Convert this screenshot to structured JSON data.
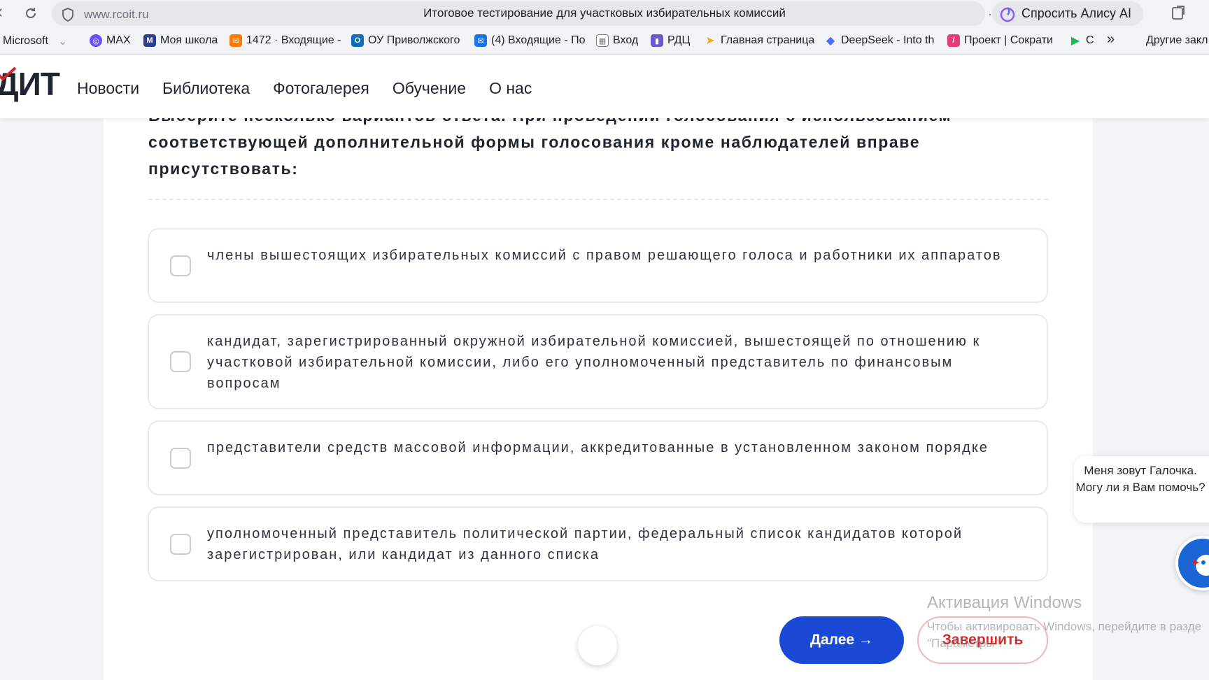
{
  "browser": {
    "url": "www.rcoit.ru",
    "tab_title": "Итоговое тестирование для участковых избирательных комиссий",
    "more": "···",
    "alice_label": "Спросить Алису AI"
  },
  "bookmarks": {
    "items": [
      {
        "label": "Microsoft",
        "icon": "microsoft-icon",
        "color": "#444"
      },
      {
        "label": "MAX",
        "icon": "max-icon",
        "color": "#6b4dff"
      },
      {
        "label": "Моя школа",
        "icon": "moya-shkola-icon",
        "color": "#2d3f8c"
      },
      {
        "label": "1472 · Входящие -",
        "icon": "mail-icon",
        "color": "#ff7a00"
      },
      {
        "label": "ОУ Приволжского",
        "icon": "outlook-icon",
        "color": "#0f6cbd"
      },
      {
        "label": "(4) Входящие - По",
        "icon": "inbox-icon",
        "color": "#1a73e8"
      },
      {
        "label": "Вход",
        "icon": "grid-icon",
        "color": "#777"
      },
      {
        "label": "РДЦ",
        "icon": "rdc-icon",
        "color": "#6a5acd"
      },
      {
        "label": "Главная страница",
        "icon": "send-icon",
        "color": "#f5a623"
      },
      {
        "label": "DeepSeek - Into th",
        "icon": "deepseek-icon",
        "color": "#4d6bfe"
      },
      {
        "label": "Проект | Сократи",
        "icon": "project-icon",
        "color": "#e63b7a"
      },
      {
        "label": "С",
        "icon": "play-icon",
        "color": "#1db954"
      }
    ],
    "more": "»",
    "other": "Другие закл"
  },
  "header": {
    "logo": "ДИТ",
    "nav": [
      "Новости",
      "Библиотека",
      "Фотогалерея",
      "Обучение",
      "О нас"
    ]
  },
  "quiz": {
    "question_lines": [
      "Выберите несколько вариантов ответа. При проведении голосования с использованием",
      "соответствующей дополнительной формы голосования кроме наблюдателей вправе",
      "присутствовать:"
    ],
    "options": [
      {
        "text": "члены вышестоящих избирательных комиссий с правом решающего голоса и работники их аппаратов",
        "checked": false
      },
      {
        "text": "кандидат, зарегистрированный окружной избирательной комиссией, вышестоящей по отношению к участковой избирательной комиссии, либо его уполномоченный представитель по финансовым вопросам",
        "checked": false
      },
      {
        "text": "представители средств массовой информации, аккредитованные в установленном законом порядке",
        "checked": false
      },
      {
        "text": "уполномоченный представитель политической партии, федеральный список кандидатов которой зарегистрирован, или кандидат из данного списка",
        "checked": false
      }
    ],
    "next_label": "Далее →",
    "finish_label": "Завершить"
  },
  "watermark": {
    "title": "Активация Windows",
    "line1": "Чтобы активировать Windows, перейдите в разде",
    "line2": "\"Параметры\"."
  },
  "chat": {
    "message": "Меня зовут Галочка. Могу ли я Вам помочь?"
  },
  "colors": {
    "primary": "#1a49d6",
    "danger": "#d12d2d",
    "chat": "#1a66d6"
  }
}
